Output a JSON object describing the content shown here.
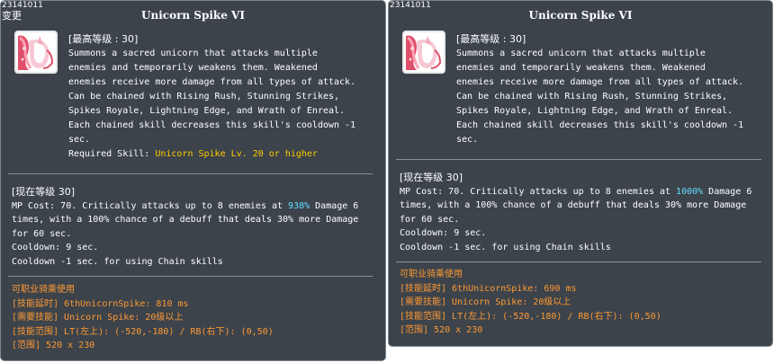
{
  "left": {
    "skill_id": "23141011",
    "change_flag": "变更",
    "title": "Unicorn Spike VI",
    "max_level": "[最高等级 : 30]",
    "desc_lines": [
      "Summons a sacred unicorn that attacks multiple",
      "enemies and temporarily weakens them. Weakened",
      "enemies receive more damage from all types of attack.",
      "Can be chained with Rising Rush, Stunning Strikes,",
      "Spikes Royale, Lightning Edge, and Wrath of Enreal.",
      "Each chained skill decreases this skill's cooldown -1",
      "sec."
    ],
    "required_label": "Required Skill: ",
    "required_value": "Unicorn Spike Lv. 20 or higher",
    "current_level": "[现在等级 30]",
    "effect_prefix": "MP Cost: 70. Critically attacks up to 8 enemies at ",
    "effect_percent": "938%",
    "effect_suffix": " Damage 6",
    "effect_lines": [
      "times, with a 100% chance of a debuff that deals 30% more Damage",
      "for 60 sec.",
      "Cooldown: 9 sec.",
      "Cooldown -1 sec. for using Chain skills"
    ],
    "info_lines": [
      "可职业骑乘使用",
      "[技能延时] 6thUnicornSpike: 810 ms",
      "[需要技能] Unicorn Spike: 20级以上",
      "[技能范围] LT(左上): (-520,-180) / RB(右下): (0,50)",
      "[范围] 520 x 230"
    ]
  },
  "right": {
    "skill_id": "23141011",
    "title": "Unicorn Spike VI",
    "max_level": "[最高等级 : 30]",
    "desc_lines": [
      "Summons a sacred unicorn that attacks multiple",
      "enemies and temporarily weakens them. Weakened",
      "enemies receive more damage from all types of attack.",
      "Can be chained with Rising Rush, Stunning Strikes,",
      "Spikes Royale, Lightning Edge, and Wrath of Enreal.",
      "Each chained skill decreases this skill's cooldown -1",
      "sec."
    ],
    "current_level": "[现在等级 30]",
    "effect_prefix": "MP Cost: 70. Critically attacks up to 8 enemies at ",
    "effect_percent": "1000%",
    "effect_suffix": " Damage 6",
    "effect_lines": [
      "times, with a 100% chance of a debuff that deals 30% more Damage",
      "for 60 sec.",
      "Cooldown: 9 sec.",
      "Cooldown -1 sec. for using Chain skills"
    ],
    "info_lines": [
      "可职业骑乘使用",
      "[技能延时] 6thUnicornSpike: 690 ms",
      "[需要技能] Unicorn Spike: 20级以上",
      "[技能范围] LT(左上): (-520,-180) / RB(右下): (0,50)",
      "[范围] 520 x 230"
    ]
  },
  "colors": {
    "panel_bg": "#3c434b",
    "panel_border": "#7e8790",
    "text": "#ffffff",
    "required_value": "#ffcc00",
    "percent_highlight": "#66ddff",
    "info_text": "#ff9933"
  },
  "icon": "unicorn-spike-skill-icon"
}
